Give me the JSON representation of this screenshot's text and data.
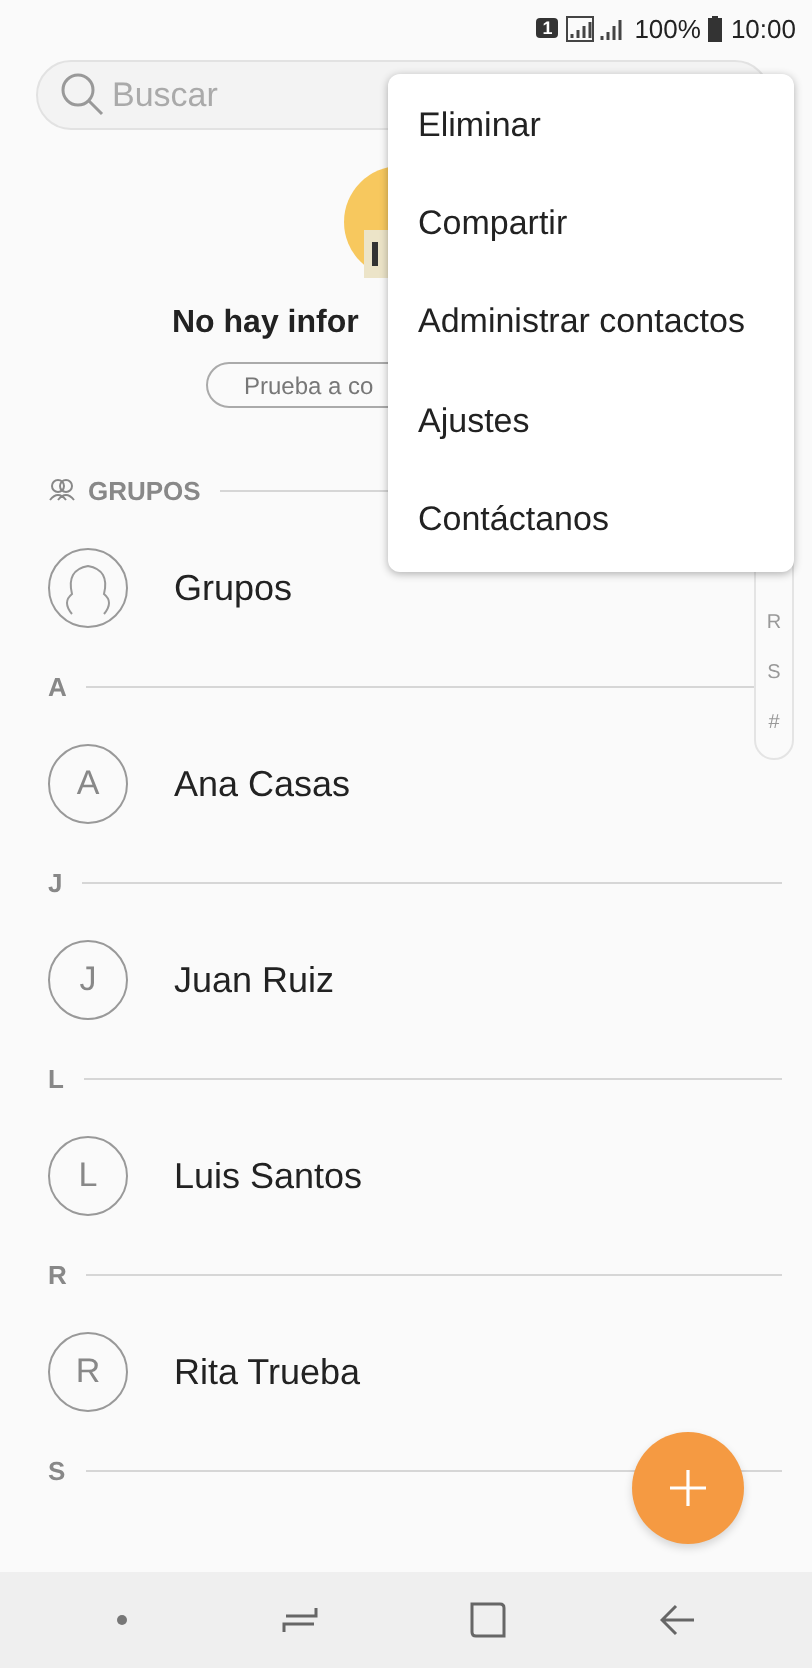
{
  "status_bar": {
    "sim": "1",
    "battery": "100%",
    "time": "10:00"
  },
  "search": {
    "placeholder": "Buscar"
  },
  "empty_state": {
    "title": "No hay infor",
    "button": "Prueba a co"
  },
  "groups_section": {
    "label": "GRUPOS",
    "item": "Grupos"
  },
  "sections": [
    {
      "letter": "A",
      "contacts": [
        {
          "initial": "A",
          "name": "Ana Casas"
        }
      ]
    },
    {
      "letter": "J",
      "contacts": [
        {
          "initial": "J",
          "name": "Juan Ruiz"
        }
      ]
    },
    {
      "letter": "L",
      "contacts": [
        {
          "initial": "L",
          "name": "Luis Santos"
        }
      ]
    },
    {
      "letter": "R",
      "contacts": [
        {
          "initial": "R",
          "name": "Rita Trueba"
        }
      ]
    },
    {
      "letter": "S"
    }
  ],
  "index_scroller": [
    "R",
    "S",
    "#"
  ],
  "menu": [
    "Eliminar",
    "Compartir",
    "Administrar contactos",
    "Ajustes",
    "Contáctanos"
  ]
}
